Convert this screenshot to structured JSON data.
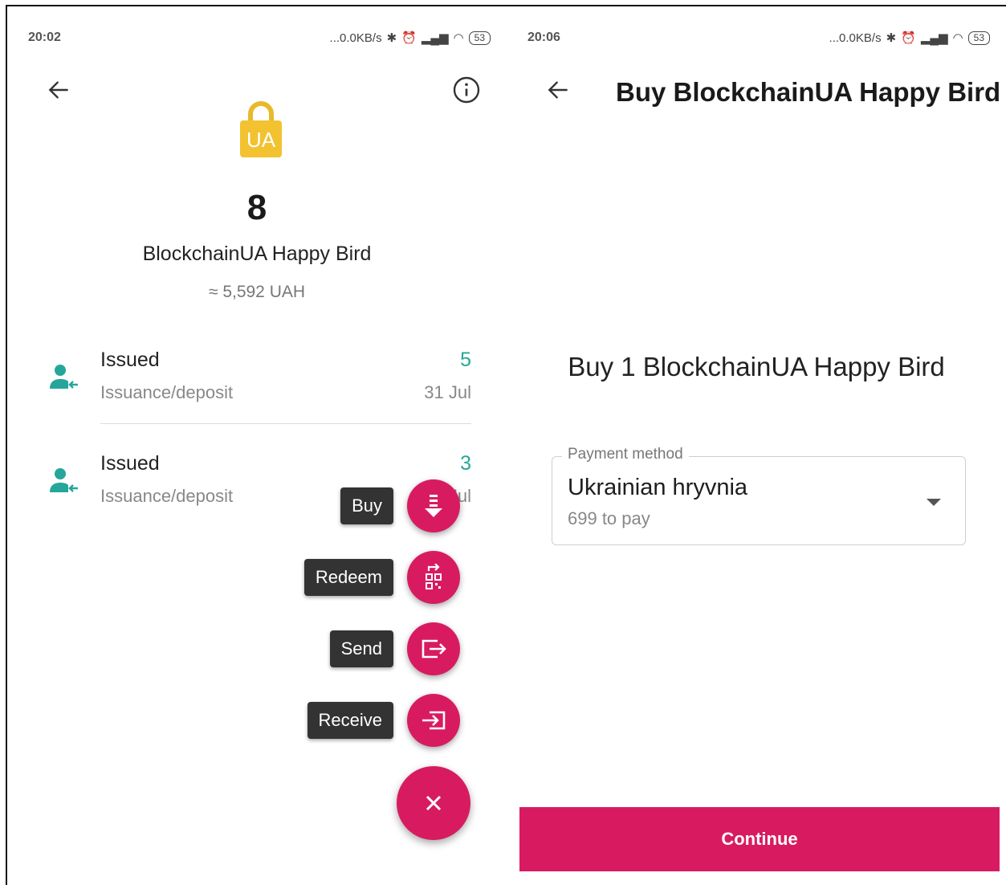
{
  "left_screen": {
    "status_bar": {
      "time": "20:02",
      "net_speed": "...0.0KB/s",
      "battery": "53"
    },
    "token": {
      "logo_text": "UA",
      "amount": "8",
      "name": "BlockchainUA Happy Bird",
      "approx_value": "≈ 5,592 UAH"
    },
    "transactions": [
      {
        "title": "Issued",
        "subtitle": "Issuance/deposit",
        "amount": "5",
        "date": "31 Jul"
      },
      {
        "title": "Issued",
        "subtitle": "Issuance/deposit",
        "amount": "3",
        "date": "31 Jul"
      }
    ],
    "fab_menu": {
      "buy_label": "Buy",
      "redeem_label": "Redeem",
      "send_label": "Send",
      "receive_label": "Receive"
    }
  },
  "right_screen": {
    "status_bar": {
      "time": "20:06",
      "net_speed": "...0.0KB/s",
      "battery": "53"
    },
    "title": "Buy BlockchainUA Happy Bird",
    "heading": "Buy 1 BlockchainUA Happy Bird",
    "payment_field": {
      "label": "Payment method",
      "value": "Ukrainian hryvnia",
      "hint": "699 to pay"
    },
    "continue_label": "Continue"
  },
  "colors": {
    "accent": "#d81b60",
    "positive": "#26a69a",
    "token_gold": "#f2c230"
  },
  "icons": {
    "back": "arrow-left-icon",
    "info": "info-icon",
    "issued": "person-incoming-icon",
    "buy": "download-list-icon",
    "redeem": "qr-redeem-icon",
    "send": "send-box-icon",
    "receive": "receive-box-icon",
    "close": "close-icon",
    "dropdown": "chevron-down-icon"
  }
}
